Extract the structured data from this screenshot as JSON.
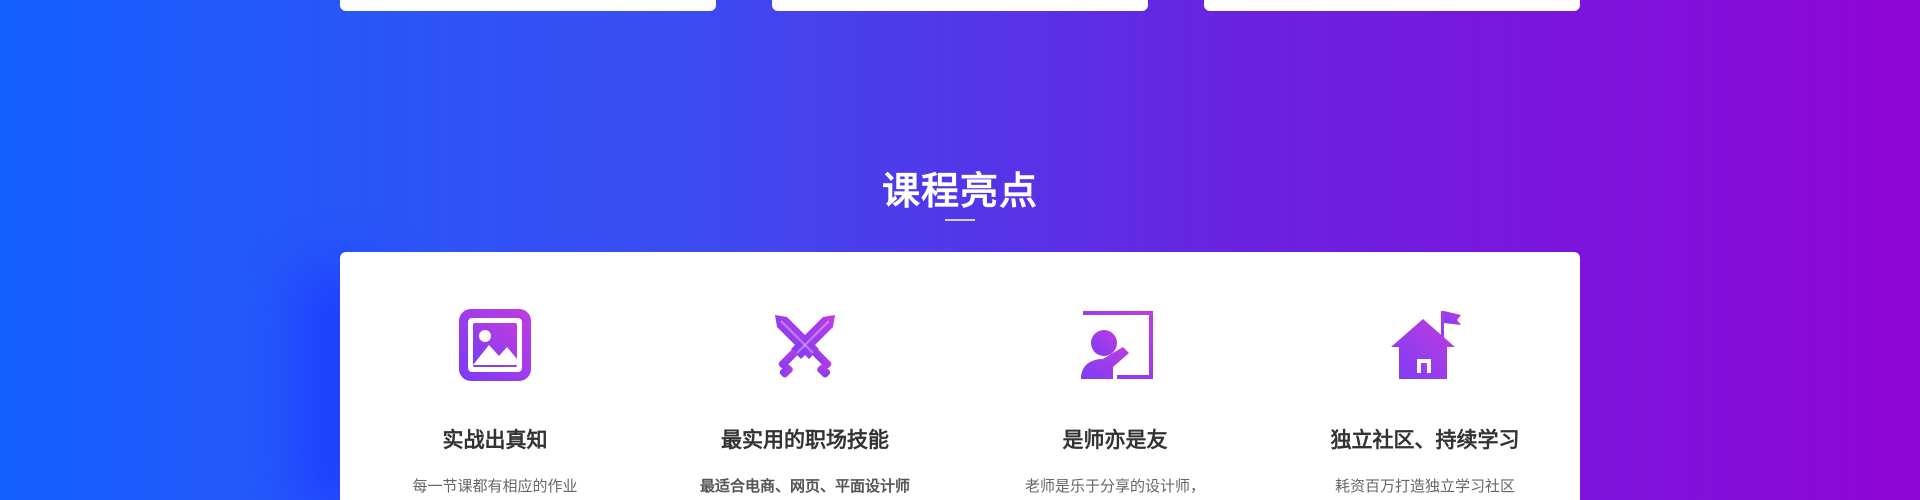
{
  "section": {
    "title": "课程亮点"
  },
  "features": [
    {
      "icon": "picture-icon",
      "title": "实战出真知",
      "description": "每一节课都有相应的作业"
    },
    {
      "icon": "crossed-swords-icon",
      "title": "最实用的职场技能",
      "description": "最适合电商、网页、平面设计师"
    },
    {
      "icon": "teacher-board-icon",
      "title": "是师亦是友",
      "description": "老师是乐于分享的设计师，"
    },
    {
      "icon": "house-flag-icon",
      "title": "独立社区、持续学习",
      "description": "耗资百万打造独立学习社区"
    }
  ],
  "colors": {
    "gradient_start": "#1560ff",
    "gradient_end": "#8f06d6",
    "icon_gradient_start": "#7b3cf5",
    "icon_gradient_end": "#c13ce0",
    "card": "#ffffff"
  }
}
